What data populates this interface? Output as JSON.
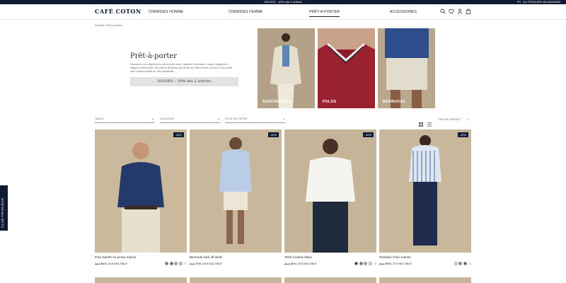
{
  "topbar": {
    "promo": "SOLDES : -50% dès 2 articles",
    "right": "FR - € ▸ TROUVER UN MAGASIN"
  },
  "header": {
    "logo": "CAFÉ COTON",
    "nav": [
      "CHEMISES HOMME",
      "CHEMISES FEMME",
      "PRÊT-À-PORTER",
      "ACCESSOIRES"
    ],
    "active_nav": "PRÊT-À-PORTER"
  },
  "breadcrumb": "Accueil  /  Prêt-à-porter",
  "hero": {
    "title": "Prêt-à-porter",
    "description": "Découvrez nos collections de prêt-à-porter chiné, maillées d'innovation, coupes élégantes et élégance intemporelle. Des pièces fermentes aux textes aux déterminées, trouvez le look parfait avec chaque modèle de votre spécificatif.",
    "sale_label": "SOLDES : -50% dès 2 articles"
  },
  "categories": [
    {
      "label": "SURCHEMISES"
    },
    {
      "label": "POLOS"
    },
    {
      "label": "BERMUDAS"
    }
  ],
  "filters": [
    {
      "label": "TAILLE"
    },
    {
      "label": "COULEUR"
    },
    {
      "label": "PLUS DE FILTRE"
    }
  ],
  "sort": {
    "label": "TRI PAR DÉFAUT"
  },
  "products": [
    {
      "name": "Polo Gareth en jersey marine",
      "old_price": "90 €",
      "price": "54 €",
      "alt_price": "45 € MULTIBUY",
      "badge": "-40%",
      "swatches": [
        "#6d7787",
        "#5b5e66",
        "#a8afc0",
        "#c9ccd4"
      ],
      "more": "+2"
    },
    {
      "name": "Bermuda Nick off-white",
      "old_price": "90 €",
      "price": "70 €",
      "alt_price": "55 € MULTIBUY",
      "badge": "-40%",
      "swatches": [],
      "more": ""
    },
    {
      "name": "Tshirt Andrew blanc",
      "old_price": "39 €",
      "price": "30 €",
      "alt_price": "25 € MULTIBUY",
      "badge": "-40%",
      "swatches": [
        "#1f2a3d",
        "#5a6e8a",
        "#9aa6b8",
        "#d8dce3"
      ],
      "more": "+2"
    },
    {
      "name": "Pantalon chino marine",
      "old_price": "99 €",
      "price": "90 €",
      "alt_price": "75 € MULTIBUY",
      "badge": "-40%",
      "swatches": [
        "#f2efe7",
        "#8a8170",
        "#6e4a35"
      ],
      "more": "+1"
    }
  ],
  "club": "CLUB PRIVILÈGE",
  "colors": {
    "navy": "#0f1b33",
    "sand": "#c8b69c"
  }
}
